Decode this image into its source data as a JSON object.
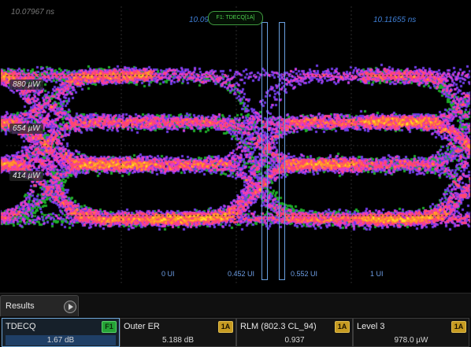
{
  "time_labels": {
    "left": "10.07967 ns",
    "middle": "10.09",
    "right": "10.11655 ns"
  },
  "marker_label": "F1: TDECQ[1A]",
  "y_labels": [
    "880 µW",
    "654 µW",
    "414 µW"
  ],
  "ui_labels": [
    "0 UI",
    "0.452 UI",
    "0.552 UI",
    "1 UI"
  ],
  "tabs": {
    "results": "Results"
  },
  "results": [
    {
      "name": "TDECQ",
      "badge": "F1",
      "value": "1.67 dB",
      "badge_color": "#25a336"
    },
    {
      "name": "Outer ER",
      "badge": "1A",
      "value": "5.188 dB",
      "badge_color": "#c69b22"
    },
    {
      "name": "RLM (802.3 CL_94)",
      "badge": "1A",
      "value": "0.937",
      "badge_color": "#c69b22"
    },
    {
      "name": "Level 3",
      "badge": "1A",
      "value": "978.0 µW",
      "badge_color": "#c69b22"
    }
  ],
  "colors": {
    "marker_blue": "#6aa0e0",
    "label_blue": "#3f7fd6",
    "eye_hot": "#ffd200",
    "eye_mid": "#ff3fa0",
    "eye_cool": "#6a3fff",
    "eye_edge": "#30d030"
  }
}
